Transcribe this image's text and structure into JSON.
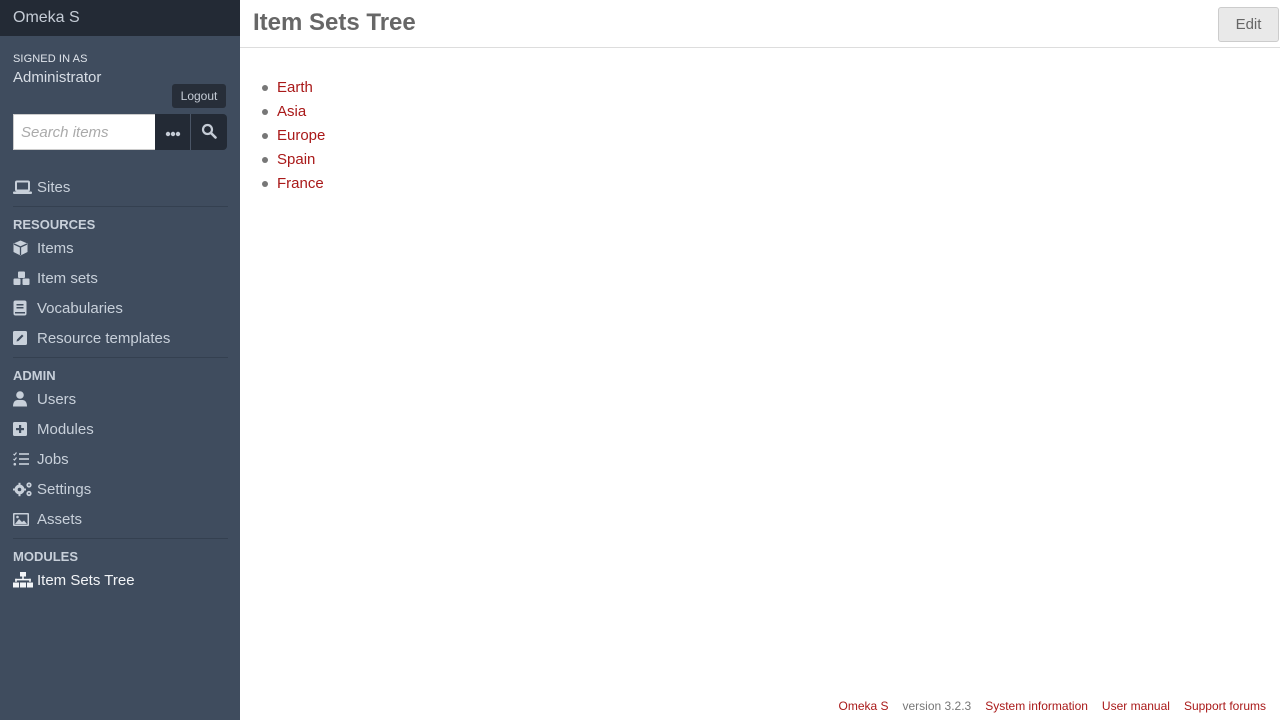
{
  "sidebar": {
    "brand": "Omeka S",
    "signed_in_label": "SIGNED IN AS",
    "user_name": "Administrator",
    "logout_label": "Logout",
    "search": {
      "placeholder": "Search items",
      "value": "",
      "advanced_icon": "ellipsis-icon",
      "submit_icon": "search-icon"
    },
    "top_items": [
      {
        "label": "Sites",
        "icon": "laptop-icon"
      }
    ],
    "sections": [
      {
        "label": "RESOURCES",
        "items": [
          {
            "label": "Items",
            "icon": "cube-icon"
          },
          {
            "label": "Item sets",
            "icon": "cubes-icon"
          },
          {
            "label": "Vocabularies",
            "icon": "book-icon"
          },
          {
            "label": "Resource templates",
            "icon": "edit-icon"
          }
        ]
      },
      {
        "label": "ADMIN",
        "items": [
          {
            "label": "Users",
            "icon": "user-icon"
          },
          {
            "label": "Modules",
            "icon": "plus-square-icon"
          },
          {
            "label": "Jobs",
            "icon": "tasks-icon"
          },
          {
            "label": "Settings",
            "icon": "cogs-icon"
          },
          {
            "label": "Assets",
            "icon": "image-icon"
          }
        ]
      },
      {
        "label": "MODULES",
        "items": [
          {
            "label": "Item Sets Tree",
            "icon": "sitemap-icon",
            "active": true
          }
        ]
      }
    ]
  },
  "main": {
    "title": "Item Sets Tree",
    "edit_label": "Edit",
    "tree_items": [
      "Earth",
      "Asia",
      "Europe",
      "Spain",
      "France"
    ]
  },
  "footer": {
    "brand_link": "Omeka S",
    "version": "version 3.2.3",
    "links": [
      "System information",
      "User manual",
      "Support forums"
    ]
  },
  "colors": {
    "sidebar_bg": "#3f4c5e",
    "brand_bg": "#232a35",
    "link": "#a91919"
  }
}
